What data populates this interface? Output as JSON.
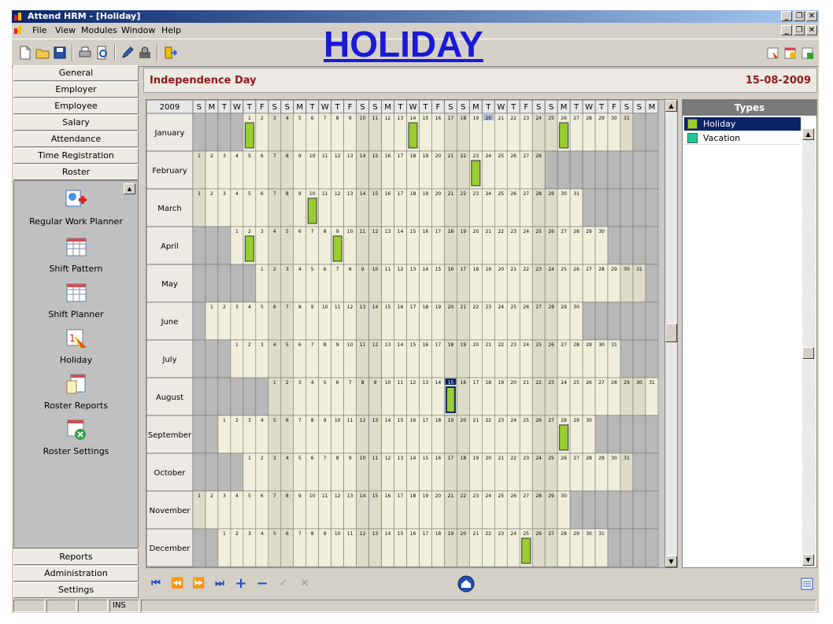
{
  "window": {
    "title": "Attend HRM - [Holiday]"
  },
  "menu": [
    "File",
    "View",
    "Modules",
    "Window",
    "Help"
  ],
  "page_title": "HOLIDAY",
  "nav_buttons": [
    "General",
    "Employer",
    "Employee",
    "Salary",
    "Attendance",
    "Time Registration",
    "Roster"
  ],
  "nav_items": [
    "Regular Work Planner",
    "Shift Pattern",
    "Shift Planner",
    "Holiday",
    "Roster Reports",
    "Roster Settings"
  ],
  "nav_bottom": [
    "Reports",
    "Administration",
    "Settings"
  ],
  "selected_holiday": {
    "name": "Independence Day",
    "date": "15-08-2009"
  },
  "calendar": {
    "year": "2009",
    "weekday_labels": [
      "S",
      "M",
      "T",
      "W",
      "T",
      "F",
      "S",
      "S",
      "M",
      "T",
      "W",
      "T",
      "F",
      "S",
      "S",
      "M",
      "T",
      "W",
      "T",
      "F",
      "S",
      "S",
      "M",
      "T",
      "W",
      "T",
      "F",
      "S",
      "S",
      "M",
      "T",
      "W",
      "T",
      "F",
      "S",
      "S",
      "M"
    ],
    "months": [
      {
        "name": "January",
        "days": 31
      },
      {
        "name": "February",
        "days": 28
      },
      {
        "name": "March",
        "days": 31
      },
      {
        "name": "April",
        "days": 30
      },
      {
        "name": "May",
        "days": 31
      },
      {
        "name": "June",
        "days": 30
      },
      {
        "name": "July",
        "days": 31
      },
      {
        "name": "August",
        "days": 31
      },
      {
        "name": "September",
        "days": 30
      },
      {
        "name": "October",
        "days": 31
      },
      {
        "name": "November",
        "days": 30
      },
      {
        "name": "December",
        "days": 31
      }
    ],
    "today": {
      "month": 1,
      "day": 20
    },
    "selected": {
      "month": 8,
      "day": 15
    },
    "holidays": [
      {
        "month": 1,
        "day": 1
      },
      {
        "month": 1,
        "day": 14
      },
      {
        "month": 1,
        "day": 26
      },
      {
        "month": 2,
        "day": 23
      },
      {
        "month": 3,
        "day": 10
      },
      {
        "month": 4,
        "day": 2
      },
      {
        "month": 4,
        "day": 9
      },
      {
        "month": 8,
        "day": 15
      },
      {
        "month": 9,
        "day": 28
      },
      {
        "month": 12,
        "day": 25
      }
    ]
  },
  "types": {
    "header": "Types",
    "items": [
      {
        "label": "Holiday",
        "color": "#9acd32",
        "selected": true
      },
      {
        "label": "Vacation",
        "color": "#20c997",
        "selected": false
      }
    ]
  },
  "status": {
    "mode": "INS"
  },
  "colors": {
    "holiday": "#9acd32",
    "weekend": "#a8a8a8",
    "day": "#f0efdc",
    "title": "#1a1ad6",
    "accent": "#8b1a1a"
  }
}
